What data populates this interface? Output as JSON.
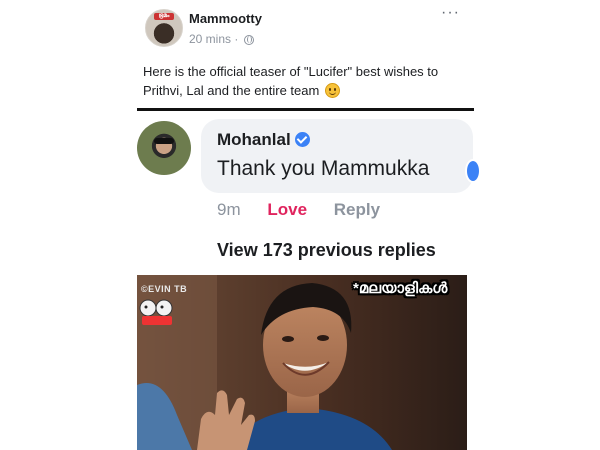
{
  "post": {
    "author": "Mammootty",
    "avatar_tag": "ഭ്രമം",
    "time": "20 mins",
    "separator": "·",
    "more": "···",
    "text": "Here is the official teaser of \"Lucifer\" best wishes to Prithvi,  Lal and the entire team",
    "icons": [
      "globe-icon",
      "smile-icon",
      "more-icon"
    ]
  },
  "reply": {
    "author": "Mohanlal",
    "text": "Thank you Mammukka",
    "time": "9m",
    "love": "Love",
    "reply": "Reply",
    "view_replies": "View 173 previous replies",
    "icons": [
      "verified-icon"
    ]
  },
  "meme": {
    "watermark": "©EVIN TB",
    "caption": "*മലയാളികൾ"
  },
  "colors": {
    "love": "#e0245e",
    "verified": "#3b82f6",
    "bubble": "#f0f2f5",
    "meta": "#8d949e"
  }
}
